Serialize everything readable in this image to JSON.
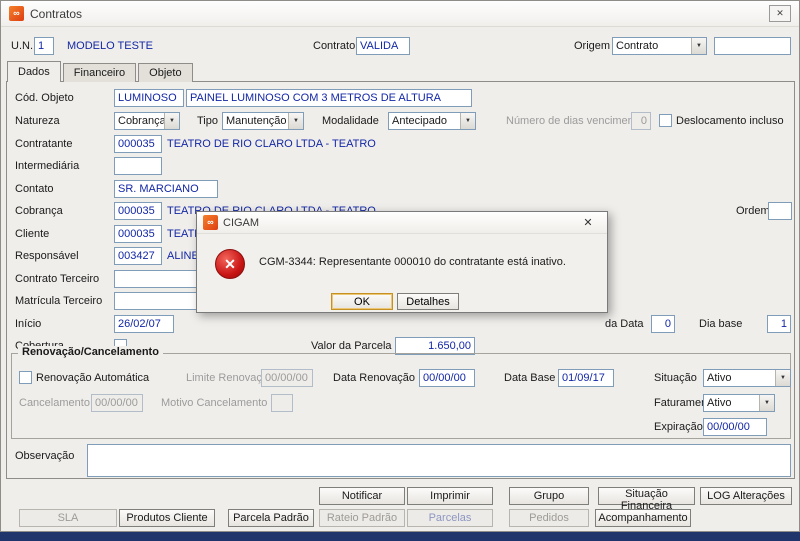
{
  "icons": {
    "close": "✕",
    "dropdown": "▼",
    "error": "✕",
    "app": "∞"
  },
  "colors": {
    "data_text": "#1327a6",
    "error_red": "#c81414",
    "brand_orange": "#e8501e"
  },
  "window": {
    "title": "Contratos"
  },
  "header": {
    "un_label": "U.N.",
    "un_value": "1",
    "un_name": "MODELO TESTE",
    "contrato_label": "Contrato",
    "contrato_value": "VALIDA",
    "origem_label": "Origem",
    "origem_value": "Contrato",
    "origem_extra_value": ""
  },
  "tabs": [
    {
      "label": "Dados"
    },
    {
      "label": "Financeiro"
    },
    {
      "label": "Objeto"
    }
  ],
  "main": {
    "cod_objeto": {
      "label": "Cód. Objeto",
      "code": "LUMINOSO",
      "desc": "PAINEL LUMINOSO COM 3 METROS DE ALTURA"
    },
    "natureza": {
      "label": "Natureza",
      "value": "Cobrança"
    },
    "tipo": {
      "label": "Tipo",
      "value": "Manutenção"
    },
    "modalidade": {
      "label": "Modalidade",
      "value": "Antecipado"
    },
    "dias_vencimento": {
      "label": "Número de dias vencimento",
      "value": "0"
    },
    "deslocamento": {
      "label": "Deslocamento incluso",
      "checked": false
    },
    "contratante": {
      "label": "Contratante",
      "code": "000035",
      "desc": "TEATRO DE RIO CLARO LTDA - TEATRO"
    },
    "intermediaria": {
      "label": "Intermediária",
      "value": ""
    },
    "contato": {
      "label": "Contato",
      "value": "SR. MARCIANO"
    },
    "cobranca": {
      "label": "Cobrança",
      "code": "000035",
      "desc": "TEATRO DE RIO CLARO LTDA - TEATRO"
    },
    "ordem": {
      "label": "Ordem",
      "value": ""
    },
    "cliente": {
      "label": "Cliente",
      "code": "000035",
      "desc": "TEATRO DE RIO CLARO LTDA - TEATRO"
    },
    "responsavel": {
      "label": "Responsável",
      "code": "003427",
      "desc": "ALINE TE"
    },
    "contrato_terceiro": {
      "label": "Contrato Terceiro",
      "value": ""
    },
    "matricula_terceiro": {
      "label": "Matrícula Terceiro",
      "value": ""
    },
    "inicio": {
      "label": "Início",
      "value": "26/02/07"
    },
    "da_data": {
      "label": "da Data",
      "value": "0"
    },
    "dia_base": {
      "label": "Dia base",
      "value": "1"
    },
    "cobertura": {
      "label": "Cobertura",
      "checked": false
    },
    "valor_parcela": {
      "label": "Valor da Parcela",
      "value": "1.650,00"
    }
  },
  "renovacao": {
    "title": "Renovação/Cancelamento",
    "renovacao_automatica": {
      "label": "Renovação Automática",
      "checked": false
    },
    "limite_renovacao": {
      "label": "Limite Renovação",
      "value": "00/00/00"
    },
    "data_renovacao": {
      "label": "Data Renovação",
      "value": "00/00/00"
    },
    "data_base": {
      "label": "Data Base",
      "value": "01/09/17"
    },
    "situacao": {
      "label": "Situação",
      "value": "Ativo"
    },
    "cancelamento": {
      "label": "Cancelamento",
      "value": "00/00/00"
    },
    "motivo_cancelamento": {
      "label": "Motivo Cancelamento",
      "value": ""
    },
    "faturamento": {
      "label": "Faturamento",
      "value": "Ativo"
    },
    "expiracao": {
      "label": "Expiração",
      "value": "00/00/00"
    }
  },
  "observacao": {
    "label": "Observação",
    "value": ""
  },
  "buttons_row1": [
    {
      "label": "Notificar"
    },
    {
      "label": "Imprimir"
    },
    {
      "label": "Grupo"
    },
    {
      "label": "Situação Financeira"
    },
    {
      "label": "LOG Alterações"
    }
  ],
  "buttons_row2": [
    {
      "label": "SLA",
      "disabled": true
    },
    {
      "label": "Produtos Cliente",
      "disabled": false
    },
    {
      "label": "Parcela Padrão",
      "disabled": false
    },
    {
      "label": "Rateio Padrão",
      "disabled": true
    },
    {
      "label": "Parcelas",
      "disabled": true
    },
    {
      "label": "Pedidos",
      "disabled": true
    },
    {
      "label": "Acompanhamento",
      "disabled": false
    }
  ],
  "dialog": {
    "title": "CIGAM",
    "message": "CGM-3344: Representante 000010 do contratante está inativo.",
    "ok_label": "OK",
    "detalhes_label": "Detalhes"
  }
}
